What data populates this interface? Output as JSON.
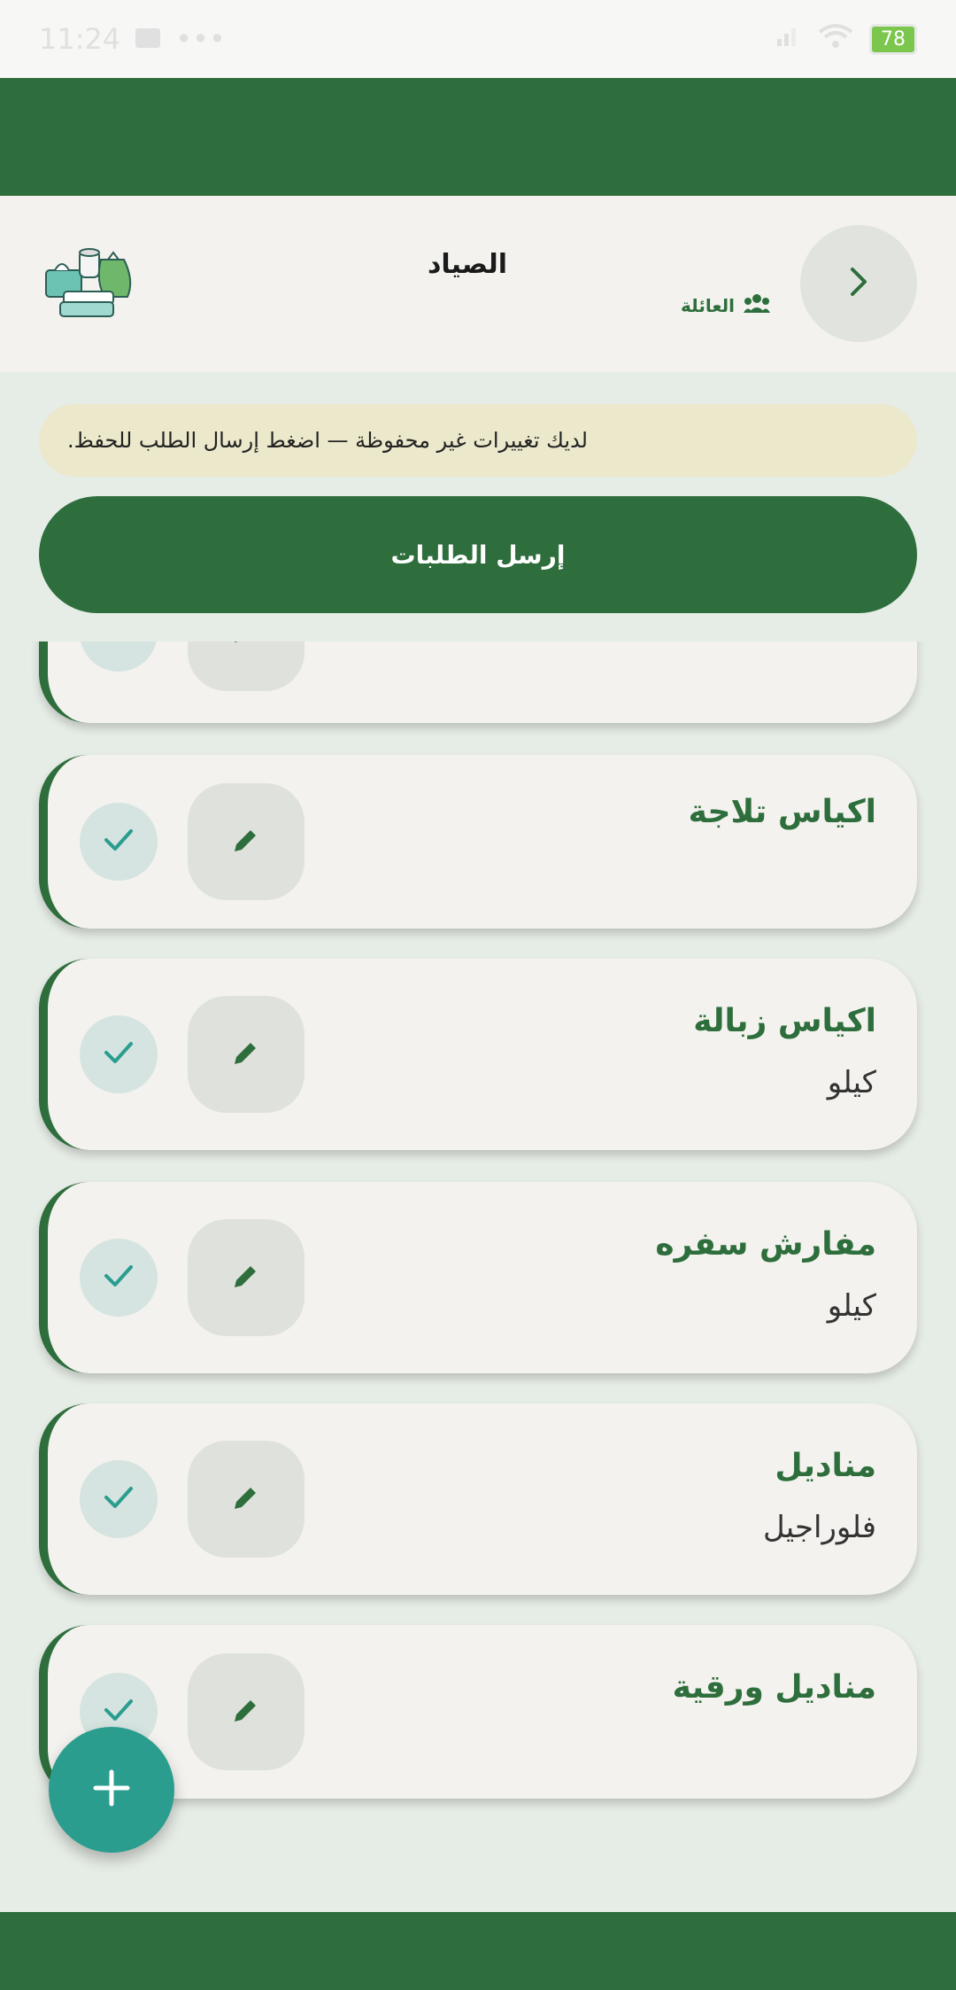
{
  "status_bar": {
    "time": "11:24",
    "dots": "•••",
    "battery": "78"
  },
  "header": {
    "title": "الصياد",
    "subtitle": "العائلة"
  },
  "notice": {
    "text": "لديك تغييرات غير محفوظة — اضغط إرسال الطلب للحفظ."
  },
  "submit": {
    "label": "إرسل الطلبات"
  },
  "items": [
    {
      "name": "",
      "unit": ""
    },
    {
      "name": "اكياس تلاجة",
      "unit": ""
    },
    {
      "name": "اكياس زبالة",
      "unit": "كيلو"
    },
    {
      "name": "مفارش سفره",
      "unit": "كيلو"
    },
    {
      "name": "مناديل",
      "unit": "فلوراجيل"
    },
    {
      "name": "مناديل ورقية",
      "unit": ""
    }
  ],
  "colors": {
    "primary": "#2d6e3c",
    "fab": "#2a9d8f",
    "card": "#f3f2ee",
    "background": "#e6ece6"
  },
  "icons": {
    "back": "chevron-right-icon",
    "family": "people-icon",
    "edit": "pencil-icon",
    "check": "check-icon",
    "add": "plus-icon"
  }
}
